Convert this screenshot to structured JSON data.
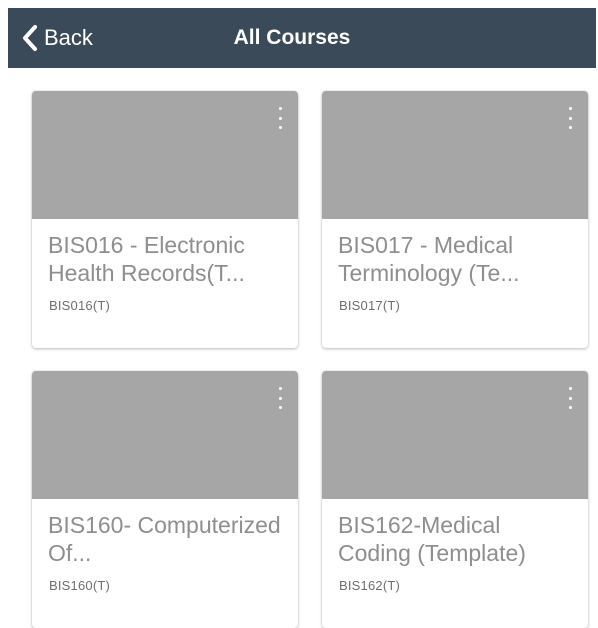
{
  "header": {
    "back_label": "Back",
    "back_icon": "chevron-left-icon",
    "title": "All Courses"
  },
  "courses": [
    {
      "title": "BIS016 - Electronic Health Records(T...",
      "code": "BIS016(T)",
      "menu_icon": "more-vertical-icon"
    },
    {
      "title": "BIS017 - Medical Terminology (Te...",
      "code": "BIS017(T)",
      "menu_icon": "more-vertical-icon"
    },
    {
      "title": "BIS160- Computerized Of...",
      "code": "BIS160(T)",
      "menu_icon": "more-vertical-icon"
    },
    {
      "title": "BIS162-Medical Coding (Template)",
      "code": "BIS162(T)",
      "menu_icon": "more-vertical-icon"
    }
  ],
  "colors": {
    "header_bg": "#3a4a58",
    "card_image": "#a6a6a6",
    "card_title": "#8e8e8e"
  }
}
